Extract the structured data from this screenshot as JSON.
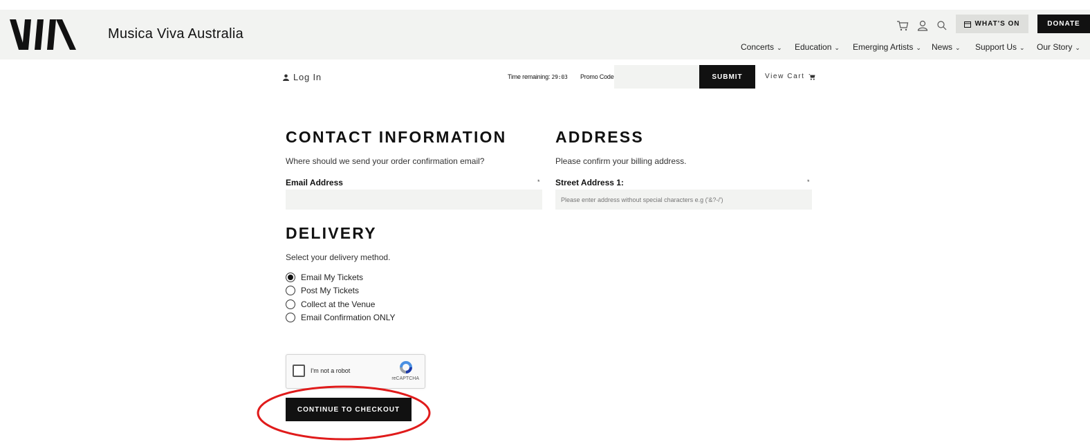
{
  "header": {
    "brand_name": "Musica Viva Australia",
    "whats_on_label": "WHAT'S ON",
    "donate_label": "DONATE",
    "nav": [
      "Concerts",
      "Education",
      "Emerging Artists",
      "News",
      "Support Us",
      "Our Story"
    ],
    "icons": [
      "cart-icon",
      "user-icon",
      "search-icon",
      "calendar-icon"
    ]
  },
  "toolbar": {
    "login_label": "Log In",
    "time_label": "Time remaining:",
    "time_value": "29:03",
    "promo_label": "Promo Code",
    "promo_value": "",
    "submit_label": "SUBMIT",
    "view_cart_label": "View Cart"
  },
  "contact": {
    "heading": "CONTACT INFORMATION",
    "subtext": "Where should we send your order confirmation email?",
    "email_label": "Email Address",
    "email_value": "",
    "required_mark": "*"
  },
  "address": {
    "heading": "ADDRESS",
    "subtext": "Please confirm your billing address.",
    "street_label": "Street Address 1:",
    "street_placeholder": "Please enter address without special characters e.g ('&?-/')",
    "required_mark": "*"
  },
  "delivery": {
    "heading": "DELIVERY",
    "subtext": "Select your delivery method.",
    "options": [
      {
        "label": "Email My Tickets",
        "selected": true
      },
      {
        "label": "Post My Tickets",
        "selected": false
      },
      {
        "label": "Collect at the Venue",
        "selected": false
      },
      {
        "label": "Email Confirmation ONLY",
        "selected": false
      }
    ]
  },
  "captcha": {
    "label": "I'm not a robot",
    "brand": "reCAPTCHA"
  },
  "cta": {
    "label": "CONTINUE TO CHECKOUT"
  },
  "colors": {
    "header_bg": "#f2f3f1",
    "button_dark": "#111111",
    "annotation_red": "#e01b1b"
  }
}
